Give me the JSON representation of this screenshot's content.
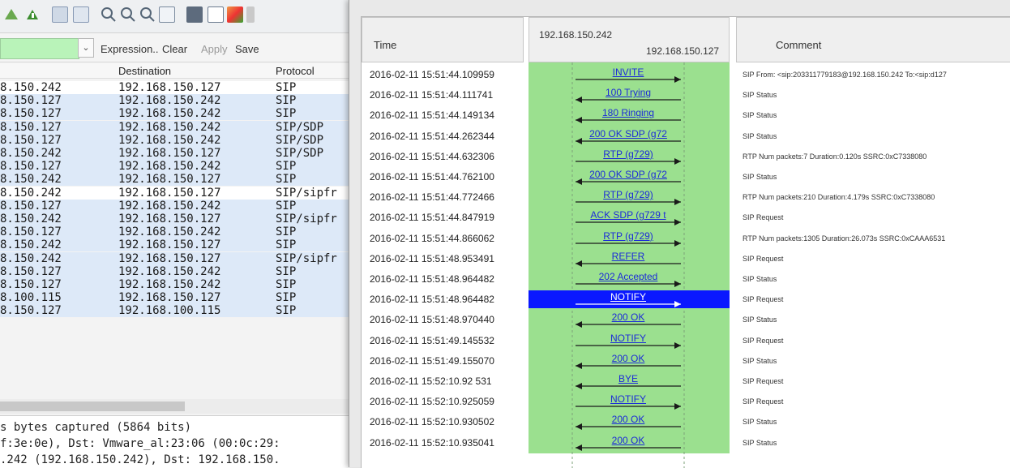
{
  "toolbar": {
    "icons": [
      "shark-fin-icon",
      "colorize-icon",
      "packet-list-icon",
      "zoom-in-icon",
      "zoom-out-icon",
      "zoom-normal-icon",
      "resize-columns-icon",
      "capture-filters-icon",
      "display-filters-icon",
      "coloring-rules-icon"
    ]
  },
  "filter_bar": {
    "dropdown_icon": "chevron-down-icon",
    "expression_label": "Expression..",
    "clear_label": "Clear",
    "apply_label": "Apply",
    "save_label": "Save"
  },
  "packet_list": {
    "columns": [
      "Destination",
      "Protocol"
    ],
    "rows": [
      {
        "src": "8.150.242",
        "dst": "192.168.150.127",
        "proto": "SIP",
        "hl": false
      },
      {
        "src": "8.150.127",
        "dst": "192.168.150.242",
        "proto": "SIP",
        "hl": true
      },
      {
        "src": "8.150.127",
        "dst": "192.168.150.242",
        "proto": "SIP",
        "hl": true
      },
      {
        "src": "8.150.127",
        "dst": "192.168.150.242",
        "proto": "SIP/SDP",
        "hl": true
      },
      {
        "src": "8.150.127",
        "dst": "192.168.150.242",
        "proto": "SIP/SDP",
        "hl": true
      },
      {
        "src": "8.150.242",
        "dst": "192.168.150.127",
        "proto": "SIP/SDP",
        "hl": true
      },
      {
        "src": "8.150.127",
        "dst": "192.168.150.242",
        "proto": "SIP",
        "hl": true
      },
      {
        "src": "8.150.242",
        "dst": "192.168.150.127",
        "proto": "SIP",
        "hl": true
      },
      {
        "src": "8.150.242",
        "dst": "192.168.150.127",
        "proto": "SIP/sipfr",
        "hl": false
      },
      {
        "src": "8.150.127",
        "dst": "192.168.150.242",
        "proto": "SIP",
        "hl": true
      },
      {
        "src": "8.150.242",
        "dst": "192.168.150.127",
        "proto": "SIP/sipfr",
        "hl": true
      },
      {
        "src": "8.150.127",
        "dst": "192.168.150.242",
        "proto": "SIP",
        "hl": true
      },
      {
        "src": "8.150.242",
        "dst": "192.168.150.127",
        "proto": "SIP",
        "hl": true
      },
      {
        "src": "8.150.242",
        "dst": "192.168.150.127",
        "proto": "SIP/sipfr",
        "hl": true
      },
      {
        "src": "8.150.127",
        "dst": "192.168.150.242",
        "proto": "SIP",
        "hl": true
      },
      {
        "src": "8.150.127",
        "dst": "192.168.150.242",
        "proto": "SIP",
        "hl": true
      },
      {
        "src": "8.100.115",
        "dst": "192.168.150.127",
        "proto": "SIP",
        "hl": true
      },
      {
        "src": "8.150.127",
        "dst": "192.168.100.115",
        "proto": "SIP",
        "hl": true
      }
    ]
  },
  "packet_detail": {
    "lines": [
      "s bytes captured (5864 bits)",
      "f:3e:0e), Dst: Vmware_al:23:06 (00:0c:29:",
      ".242 (192.168.150.242), Dst: 192.168.150."
    ]
  },
  "flow_dialog": {
    "time_header": "Time",
    "host_a": "192.168.150.242",
    "host_b": "192.168.150.127",
    "comment_header": "Comment",
    "rows": [
      {
        "time": "2016-02-11 15:51:44.109959",
        "label": "INVITE",
        "dir": "right",
        "comment": "SIP From: <sip:203311779183@192.168.150.242 To:<sip:d127",
        "sel": false
      },
      {
        "time": "2016-02-11 15:51:44.111741",
        "label": "100 Trying",
        "dir": "left",
        "comment": "SIP Status",
        "sel": false
      },
      {
        "time": "2016-02-11 15:51:44.149134",
        "label": "180 Ringing",
        "dir": "left",
        "comment": "SIP Status",
        "sel": false
      },
      {
        "time": "2016-02-11 15:51:44.262344",
        "label": "200 OK SDP (g72",
        "dir": "left",
        "comment": "SIP Status",
        "sel": false
      },
      {
        "time": "2016-02-11 15:51:44.632306",
        "label": "RTP (g729)",
        "dir": "right",
        "comment": "RTP Num packets:7  Duration:0.120s SSRC:0xC7338080",
        "sel": false
      },
      {
        "time": "2016-02-11 15:51:44.762100",
        "label": "200 OK SDP (g72",
        "dir": "left",
        "comment": "SIP Status",
        "sel": false
      },
      {
        "time": "2016-02-11 15:51:44.772466",
        "label": "RTP (g729)",
        "dir": "right",
        "comment": "RTP Num packets:210  Duration:4.179s SSRC:0xC7338080",
        "sel": false
      },
      {
        "time": "2016-02-11 15:51:44.847919",
        "label": "ACK SDP (g729 t",
        "dir": "right",
        "comment": "SIP Request",
        "sel": false
      },
      {
        "time": "2016-02-11 15:51:44.866062",
        "label": "RTP (g729)",
        "dir": "right",
        "comment": "RTP Num packets:1305  Duration:26.073s SSRC:0xCAAA6531",
        "sel": false
      },
      {
        "time": "2016-02-11 15:51:48.953491",
        "label": "REFER",
        "dir": "left",
        "comment": "SIP Request",
        "sel": false
      },
      {
        "time": "2016-02-11 15:51:48.964482",
        "label": "202 Accepted",
        "dir": "right",
        "comment": "SIP Status",
        "sel": false
      },
      {
        "time": "2016-02-11 15:51:48.964482",
        "label": "NOTIFY",
        "dir": "right",
        "comment": "SIP Request",
        "sel": true
      },
      {
        "time": "2016-02-11 15:51:48.970440",
        "label": "200 OK",
        "dir": "left",
        "comment": "SIP Status",
        "sel": false
      },
      {
        "time": "2016-02-11 15:51:49.145532",
        "label": "NOTIFY",
        "dir": "right",
        "comment": "SIP Request",
        "sel": false
      },
      {
        "time": "2016-02-11 15:51:49.155070",
        "label": "200 OK",
        "dir": "left",
        "comment": "SIP Status",
        "sel": false
      },
      {
        "time": "2016-02-11 15:52:10.92 531",
        "label": "BYE",
        "dir": "left",
        "comment": "SIP Request",
        "sel": false
      },
      {
        "time": "2016-02-11 15:52:10.925059",
        "label": "NOTIFY",
        "dir": "right",
        "comment": "SIP Request",
        "sel": false
      },
      {
        "time": "2016-02-11 15:52:10.930502",
        "label": "200 OK",
        "dir": "left",
        "comment": "SIP Status",
        "sel": false
      },
      {
        "time": "2016-02-11 15:52:10.935041",
        "label": "200 OK",
        "dir": "left",
        "comment": "SIP Status",
        "sel": false
      }
    ]
  },
  "colors": {
    "flow_green": "#9be08f",
    "selected_blue": "#0a18ff",
    "row_highlight": "#dde9f8",
    "filter_green": "#b9f3b9"
  }
}
